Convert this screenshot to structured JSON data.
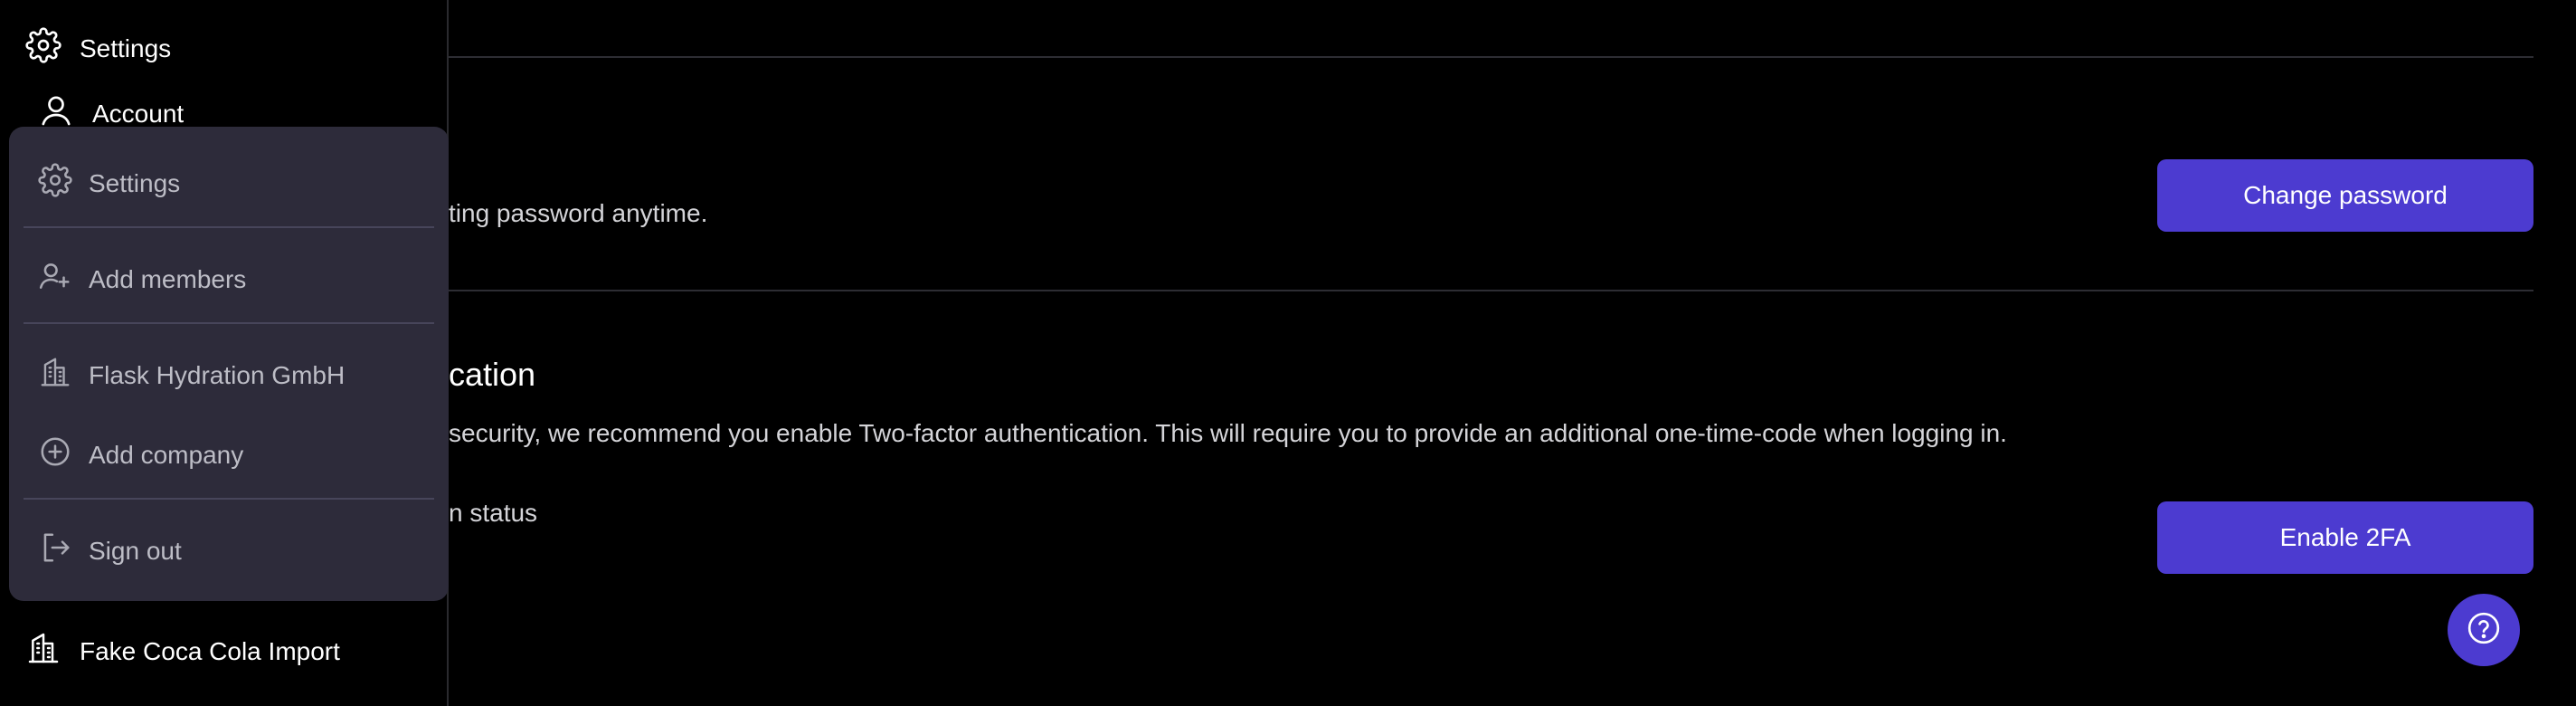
{
  "sidebar": {
    "settings_label": "Settings",
    "account_label": "Account",
    "company_label": "Fake Coca Cola Import"
  },
  "dropdown": {
    "settings_label": "Settings",
    "add_members_label": "Add members",
    "company_label": "Flask Hydration GmbH",
    "add_company_label": "Add company",
    "sign_out_label": "Sign out"
  },
  "password_section": {
    "description_visible": "ting password anytime.",
    "button_label": "Change password"
  },
  "twofa_section": {
    "heading_visible": "cation",
    "description_visible": "security, we recommend you enable Two-factor authentication. This will require you to provide an additional one-time-code when logging in.",
    "status_visible": "n status",
    "button_label": "Enable 2FA"
  },
  "colors": {
    "background": "#000000",
    "accent": "#4c3bd0",
    "dropdown_bg": "#2d2b3a"
  },
  "icons": {
    "help": "question-icon"
  }
}
